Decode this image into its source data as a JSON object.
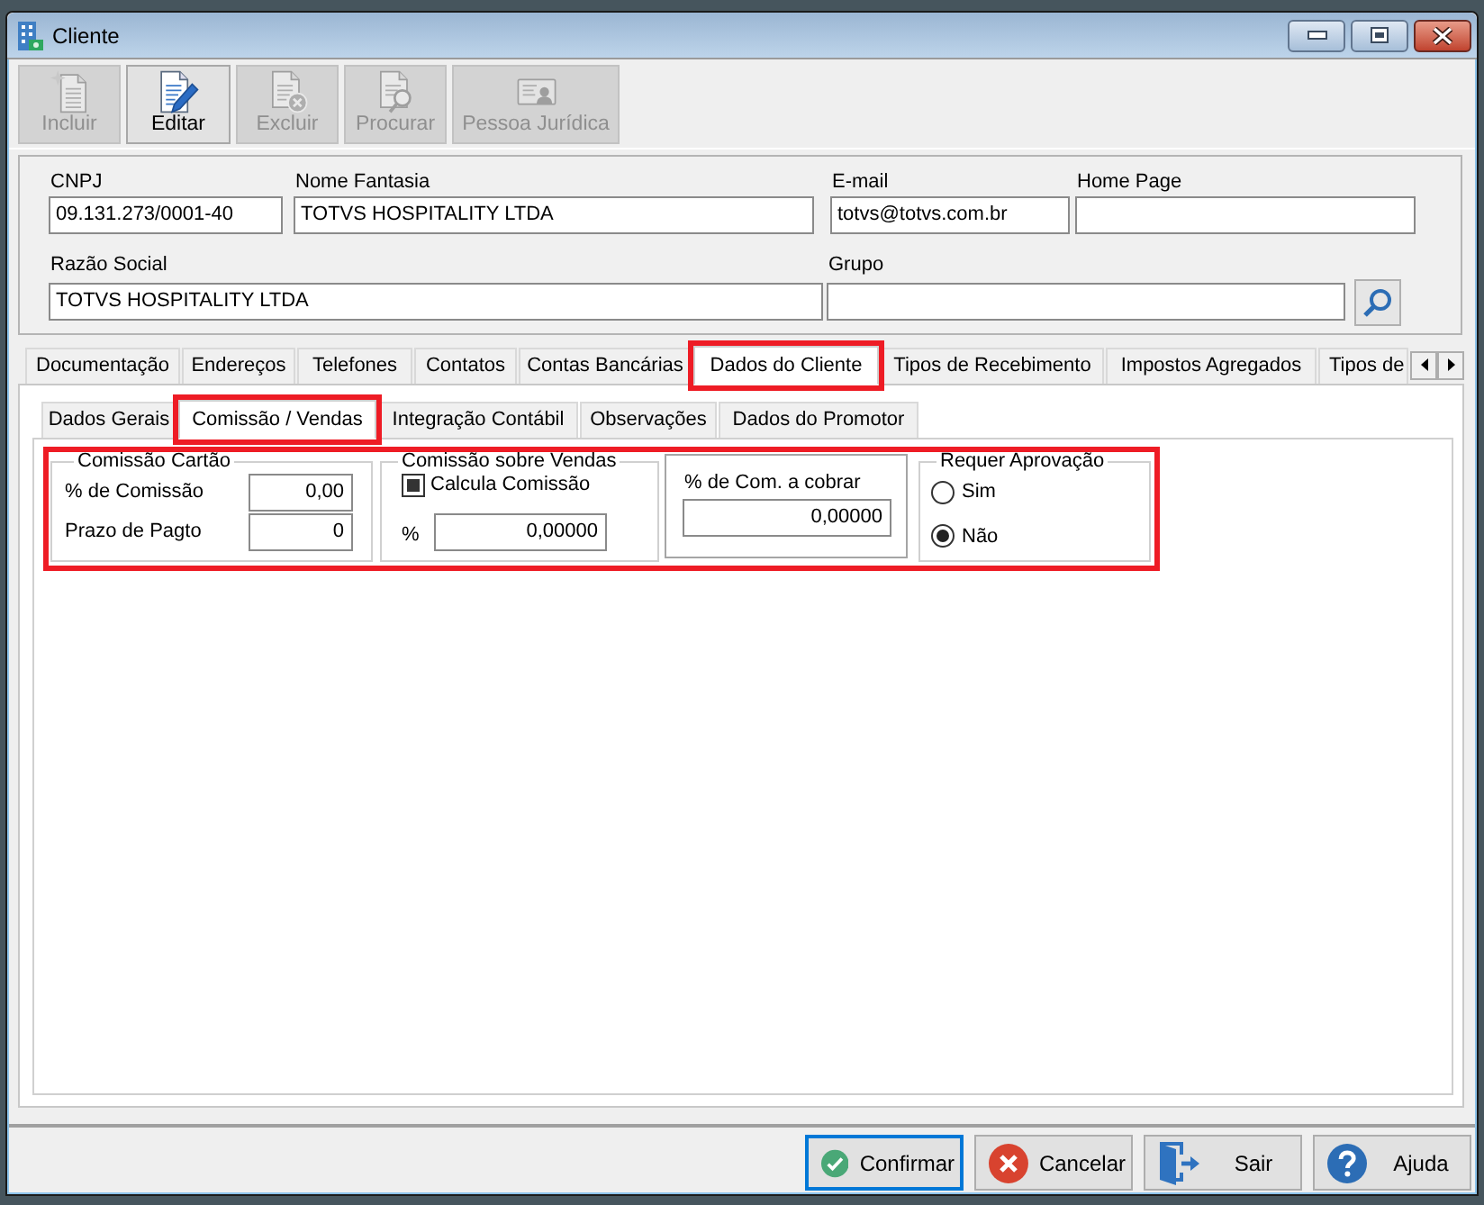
{
  "window": {
    "title": "Cliente"
  },
  "toolbar": [
    {
      "label": "Incluir",
      "disabled": true
    },
    {
      "label": "Editar",
      "disabled": false
    },
    {
      "label": "Excluir",
      "disabled": true
    },
    {
      "label": "Procurar",
      "disabled": true
    },
    {
      "label": "Pessoa Jurídica",
      "disabled": true
    }
  ],
  "header": {
    "fields": [
      {
        "label": "CNPJ",
        "value": "09.131.273/0001-40"
      },
      {
        "label": "Nome Fantasia",
        "value": "TOTVS HOSPITALITY LTDA"
      },
      {
        "label": "E-mail",
        "value": "totvs@totvs.com.br"
      },
      {
        "label": "Home Page"
      },
      {
        "label": "Razão Social",
        "value": "TOTVS HOSPITALITY LTDA"
      },
      {
        "label": "Grupo"
      }
    ]
  },
  "main_tabs": [
    {
      "label": "Documentação",
      "selected": false,
      "highlighted": false
    },
    {
      "label": "Endereços",
      "selected": false,
      "highlighted": false
    },
    {
      "label": "Telefones",
      "selected": false,
      "highlighted": false
    },
    {
      "label": "Contatos",
      "selected": false,
      "highlighted": false
    },
    {
      "label": "Contas Bancárias",
      "selected": false,
      "highlighted": false
    },
    {
      "label": "Dados do Cliente",
      "selected": true,
      "highlighted": true
    },
    {
      "label": "Tipos de Recebimento",
      "selected": false,
      "highlighted": false
    },
    {
      "label": "Impostos Agregados",
      "selected": false,
      "highlighted": false
    },
    {
      "label": "Tipos de",
      "selected": false,
      "highlighted": false
    }
  ],
  "sub_tabs": [
    {
      "label": "Dados Gerais",
      "selected": false,
      "highlighted": false
    },
    {
      "label": "Comissão / Vendas",
      "selected": true,
      "highlighted": true
    },
    {
      "label": "Integração Contábil",
      "selected": false,
      "highlighted": false
    },
    {
      "label": "Observações",
      "selected": false,
      "highlighted": false
    },
    {
      "label": "Dados do Promotor",
      "selected": false,
      "highlighted": false
    }
  ],
  "commission": {
    "highlighted": true,
    "card": {
      "title": "Comissão Cartão",
      "fields": [
        {
          "label": "% de Comissão",
          "value": "0,00"
        },
        {
          "label": "Prazo de Pagto",
          "value": "0"
        }
      ]
    },
    "sales": {
      "title": "Comissão sobre Vendas",
      "checkbox": {
        "label": "Calcula Comissão",
        "checked": true
      },
      "field": {
        "label": "%",
        "value": "0,00000"
      }
    },
    "charge": {
      "label": "% de Com. a cobrar",
      "value": "0,00000"
    },
    "approval": {
      "title": "Requer Aprovação",
      "options": [
        {
          "label": "Sim",
          "selected": false
        },
        {
          "label": "Não",
          "selected": true
        }
      ]
    }
  },
  "buttons": [
    {
      "label": "Confirmar",
      "focused": true
    },
    {
      "label": "Cancelar",
      "focused": false
    },
    {
      "label": "Sair",
      "focused": false
    },
    {
      "label": "Ajuda",
      "focused": false
    }
  ]
}
